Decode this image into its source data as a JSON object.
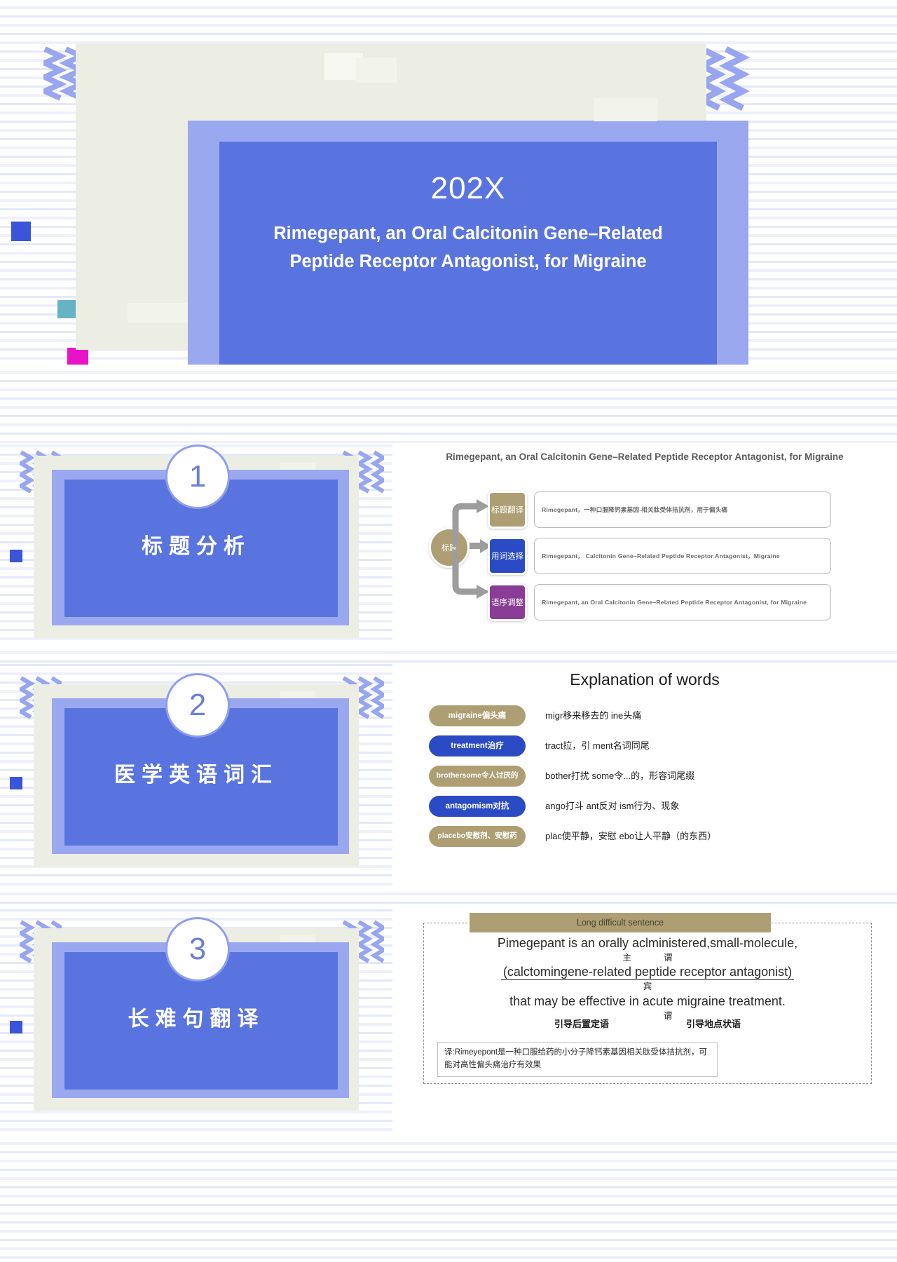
{
  "slide1": {
    "year": "202X",
    "title": "Rimegepant, an Oral Calcitonin Gene–Related Peptide Receptor Antagonist, for Migraine"
  },
  "sections": [
    {
      "number": "1",
      "label": "标题分析"
    },
    {
      "number": "2",
      "label": "医学英语词汇"
    },
    {
      "number": "3",
      "label": "长难句翻译"
    }
  ],
  "diagram": {
    "title": "Rimegepant, an Oral Calcitonin Gene–Related Peptide Receptor Antagonist, for Migraine",
    "hub": "标题",
    "rows": [
      {
        "tag": "标题翻译",
        "tag_color": "#ad9f73",
        "text": "Rimegepant，一种口服降钙素基因-相关肽受体拮抗剂，用于偏头痛"
      },
      {
        "tag": "用词选择",
        "tag_color": "#2b4bc4",
        "text": "Rimegepant， Calcitonin Gene–Related Peptide Receptor Antagonist，Migraine"
      },
      {
        "tag": "语序调整",
        "tag_color": "#8a3d96",
        "text": "Rimegepant, an Oral Calcitonin Gene–Related Peptide Receptor Antagonist, for Migraine"
      }
    ]
  },
  "explanation": {
    "title": "Explanation of words",
    "words": [
      {
        "term": "migraine偏头痛",
        "color": "#ad9f73",
        "definition": "migr移来移去的  ine头痛"
      },
      {
        "term": "treatment治疗",
        "color": "#2b4bc4",
        "definition": "tract拉，引  ment名词同尾"
      },
      {
        "term": "brothersome令人讨厌的",
        "color": "#ad9f73",
        "definition": "bother打扰    some令...的，形容词尾缀"
      },
      {
        "term": "antagomism对抗",
        "color": "#2b4bc4",
        "definition": "ango打斗  ant反对  ism行为、现象"
      },
      {
        "term": "placebo安慰剂、安慰药",
        "color": "#ad9f73",
        "definition": "plac使平静，安慰  ebo让人平静（的东西）"
      }
    ]
  },
  "long_sentence": {
    "header": "Long difficult sentence",
    "line1": "Pimegepant is an orally aclministered,small-molecule,",
    "mark1_left": "主",
    "mark1_right": "谓",
    "line2": "(calctomingene-related peptide receptor antagonist)",
    "mark2": "宾",
    "line3": "that may be effective in acute migraine treatment.",
    "mark3": "谓",
    "tag_left": "引导后置定语",
    "tag_right": "引导地点状语",
    "translation": "译:Rimeyepont是一种口服给药的小分子降钙素基因相关肽受体拮抗剂，可能对高性偏头痛治疗有效果"
  },
  "colors": {
    "accent_blue": "#5a74df",
    "lavender": "#9aa8f0",
    "cream": "#edeee3",
    "tan": "#ad9f73",
    "purple": "#8a3d96",
    "magenta": "#e812c9",
    "teal": "#67b2c4"
  }
}
